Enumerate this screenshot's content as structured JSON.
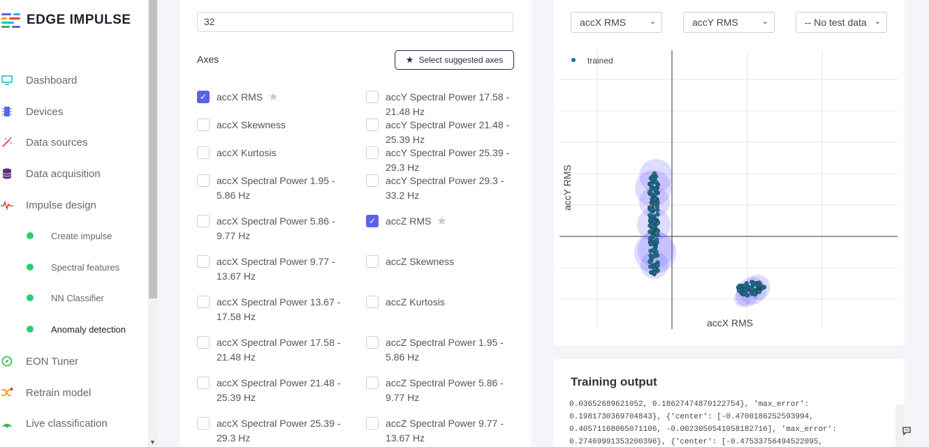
{
  "brand": {
    "name": "EDGE IMPULSE"
  },
  "sidebar": {
    "items": [
      {
        "label": "Dashboard",
        "icon": "monitor-icon",
        "color": "#22b8cf"
      },
      {
        "label": "Devices",
        "icon": "chip-icon",
        "color": "#5b63e6"
      },
      {
        "label": "Data sources",
        "icon": "wand-icon",
        "color": "#e64980"
      },
      {
        "label": "Data acquisition",
        "icon": "database-icon",
        "color": "#5a2d82"
      },
      {
        "label": "Impulse design",
        "icon": "pulse-icon",
        "color": "#f03e3e"
      }
    ],
    "subitems": [
      {
        "label": "Create impulse"
      },
      {
        "label": "Spectral features"
      },
      {
        "label": "NN Classifier"
      },
      {
        "label": "Anomaly detection",
        "active": true
      }
    ],
    "items_after": [
      {
        "label": "EON Tuner",
        "icon": "compass-icon",
        "color": "#2fb344"
      },
      {
        "label": "Retrain model",
        "icon": "shuffle-icon",
        "color": "#f59f00"
      },
      {
        "label": "Live classification",
        "icon": "signal-icon",
        "color": "#2fb344"
      }
    ]
  },
  "form": {
    "k_value": "32",
    "axes_title": "Axes",
    "suggest_label": "Select suggested axes"
  },
  "axes_left": [
    {
      "label": "accX RMS",
      "checked": true,
      "star": true
    },
    {
      "label": "accX Skewness"
    },
    {
      "label": "accX Kurtosis"
    },
    {
      "label": "accX Spectral Power 1.95 - 5.86 Hz"
    },
    {
      "label": "accX Spectral Power 5.86 - 9.77 Hz"
    },
    {
      "label": "accX Spectral Power 9.77 - 13.67 Hz"
    },
    {
      "label": "accX Spectral Power 13.67 - 17.58 Hz"
    },
    {
      "label": "accX Spectral Power 17.58 - 21.48 Hz"
    },
    {
      "label": "accX Spectral Power 21.48 - 25.39 Hz"
    },
    {
      "label": "accX Spectral Power 25.39 - 29.3 Hz"
    }
  ],
  "axes_right": [
    {
      "label": "accY Spectral Power 17.58 - 21.48 Hz"
    },
    {
      "label": "accY Spectral Power 21.48 - 25.39 Hz"
    },
    {
      "label": "accY Spectral Power 25.39 - 29.3 Hz"
    },
    {
      "label": "accY Spectral Power 29.3 - 33.2 Hz"
    },
    {
      "label": "accZ RMS",
      "checked": true,
      "star": true
    },
    {
      "label": "accZ Skewness"
    },
    {
      "label": "accZ Kurtosis"
    },
    {
      "label": "accZ Spectral Power 1.95 - 5.86 Hz"
    },
    {
      "label": "accZ Spectral Power 5.86 - 9.77 Hz"
    },
    {
      "label": "accZ Spectral Power 9.77 - 13.67 Hz"
    }
  ],
  "plot": {
    "x_select": "accX RMS",
    "y_select": "accY RMS",
    "test_select": "-- No test data",
    "legend_label": "trained",
    "xlabel": "accX RMS",
    "ylabel": "accY RMS",
    "point_color": "#1f6f8b",
    "cluster_color": "#6c63ff"
  },
  "training": {
    "title": "Training output",
    "log": "0.03652689621052, 0.18627474870122754}, 'max_error':\n0.1981730369704843}, {'center': [-0.4700186252593994,\n0.40571168065071106, -0.0023050541058182716], 'max_error':\n0.27469991353200396}, {'center': [-0.47533756494522095,"
  }
}
